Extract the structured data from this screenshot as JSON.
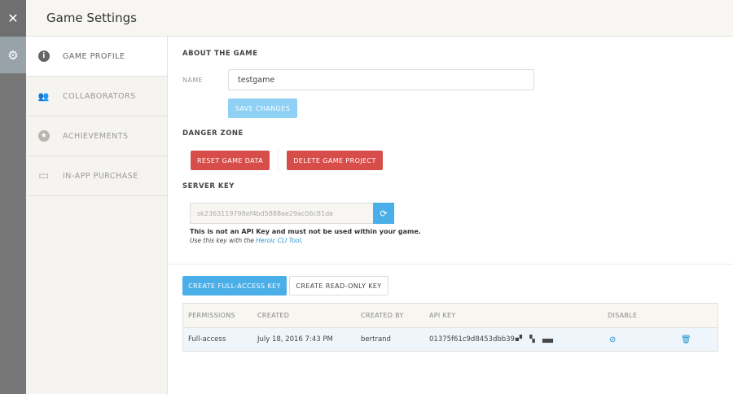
{
  "header": {
    "title": "Game Settings"
  },
  "rail": {
    "close": "✕",
    "gear": "⚙"
  },
  "sidebar": {
    "items": [
      {
        "label": "GAME PROFILE",
        "icon": "info-icon",
        "glyph": "i"
      },
      {
        "label": "COLLABORATORS",
        "icon": "people-icon",
        "glyph": "👥"
      },
      {
        "label": "ACHIEVEMENTS",
        "icon": "star-badge-icon",
        "glyph": "★"
      },
      {
        "label": "IN-APP PURCHASE",
        "icon": "credit-card-icon",
        "glyph": "▭"
      }
    ]
  },
  "about": {
    "heading": "ABOUT THE GAME",
    "name_label": "NAME",
    "name_value": "testgame",
    "save": "SAVE CHANGES"
  },
  "danger": {
    "heading": "DANGER ZONE",
    "reset": "RESET GAME DATA",
    "delete": "DELETE GAME PROJECT"
  },
  "server": {
    "heading": "SERVER KEY",
    "key": "sk2363119798ef4bd5888ae29ac06c81de",
    "warning": "This is not an API Key and must not be used within your game.",
    "note_prefix": "Use this key with the ",
    "note_link": "Heroic CLI Tool",
    "note_suffix": "."
  },
  "keys": {
    "create_full": "CREATE FULL-ACCESS KEY",
    "create_read": "CREATE READ-ONLY KEY",
    "columns": [
      "PERMISSIONS",
      "CREATED",
      "CREATED BY",
      "API KEY",
      "DISABLE"
    ],
    "rows": [
      {
        "permissions": "Full-access",
        "created": "July 18, 2016 7:43 PM",
        "created_by": "bertrand",
        "api_key": "01375f61c9d8453dbb39▪▘ ▝▖ ▗▄▖"
      }
    ]
  },
  "colors": {
    "accent": "#4aaee8",
    "danger": "#d64d4a"
  }
}
